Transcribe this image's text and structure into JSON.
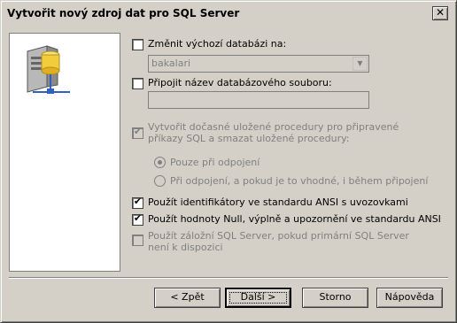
{
  "window": {
    "title": "Vytvořit nový zdroj dat pro SQL Server",
    "close_glyph": "✕"
  },
  "options": {
    "change_default_db": {
      "label": "Změnit výchozí databázi na:",
      "checked": false
    },
    "default_db_value": "bakalari",
    "attach_db_file": {
      "label": "Připojit název databázového souboru:",
      "checked": false
    },
    "db_file_value": "",
    "create_temp_procs": {
      "label": "Vytvořit dočasné uložené procedury pro připravené příkazy SQL a smazat uložené procedury:",
      "checked": true,
      "disabled": true
    },
    "radio_only_on_disconnect": {
      "label": "Pouze při odpojení",
      "selected": true
    },
    "radio_on_disconnect_and_while_connected": {
      "label": "Při odpojení, a pokud je to vhodné, i během připojení",
      "selected": false
    },
    "ansi_quoted_identifiers": {
      "label": "Použít identifikátory ve standardu ANSI s uvozovkami",
      "checked": true
    },
    "ansi_nulls_padding_warnings": {
      "label": "Použít hodnoty Null, výplně a upozornění ve standardu ANSI",
      "checked": true
    },
    "failover_server": {
      "label": "Použít záložní SQL Server, pokud primární SQL Server není k dispozici",
      "checked": false,
      "disabled": true
    }
  },
  "buttons": {
    "back": "< Zpět",
    "next": "Další >",
    "cancel": "Storno",
    "help": "Nápověda"
  },
  "icons": {
    "server": "database-server-icon",
    "checkmark": "✔",
    "dropdown": "▼"
  }
}
